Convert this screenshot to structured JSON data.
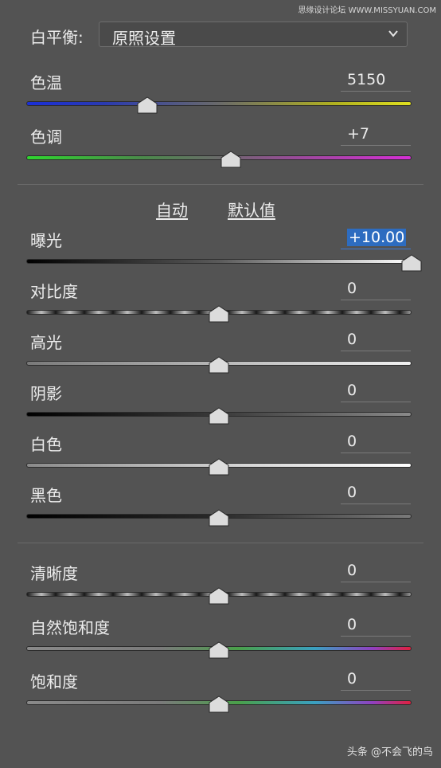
{
  "watermark": "思缘设计论坛 WWW.MISSYUAN.COM",
  "white_balance": {
    "label": "白平衡:",
    "value": "原照设置"
  },
  "actions": {
    "auto": "自动",
    "default": "默认值"
  },
  "sliders": [
    {
      "id": "temperature",
      "label": "色温",
      "value": "5150",
      "position": 0.315,
      "gradient": "linear-gradient(to right,#1a2fd8,#2a3ab0 20%,#6a6a6a 50%,#b0b020 80%,#e0e020)"
    },
    {
      "id": "tint",
      "label": "色调",
      "value": "+7",
      "position": 0.53,
      "gradient": "linear-gradient(to right,#2fd52f,#4a8a4a 30%,#6a6a6a 50%,#9a4a9a 70%,#d52fd5)"
    },
    {
      "id": "exposure",
      "label": "曝光",
      "value": "+10.00",
      "position": 1.0,
      "selected": true,
      "gradient": "linear-gradient(to right,#000000,#5a5a5a 50%,#ffffff)"
    },
    {
      "id": "contrast",
      "label": "对比度",
      "value": "0",
      "position": 0.5,
      "gradient": "repeating-linear-gradient(to right,#1a1a1a 0px,#bdbdbd 18px,#1a1a1a 36px)"
    },
    {
      "id": "highlights",
      "label": "高光",
      "value": "0",
      "position": 0.5,
      "gradient": "linear-gradient(to right,#7a7a7a,#b8b8b8 50%,#f2f2f2)"
    },
    {
      "id": "shadows",
      "label": "阴影",
      "value": "0",
      "position": 0.5,
      "gradient": "linear-gradient(to right,#000000,#3a3a3a 50%,#8a8a8a)"
    },
    {
      "id": "whites",
      "label": "白色",
      "value": "0",
      "position": 0.5,
      "gradient": "linear-gradient(to right,#8a8a8a,#cfcfcf 50%,#ffffff)"
    },
    {
      "id": "blacks",
      "label": "黑色",
      "value": "0",
      "position": 0.5,
      "gradient": "linear-gradient(to right,#000000,#2a2a2a 50%,#7a7a7a)"
    },
    {
      "id": "clarity",
      "label": "清晰度",
      "value": "0",
      "position": 0.5,
      "gradient": "repeating-linear-gradient(to right,#1a1a1a 0px,#bdbdbd 18px,#1a1a1a 36px)"
    },
    {
      "id": "vibrance",
      "label": "自然饱和度",
      "value": "0",
      "position": 0.5,
      "gradient": "linear-gradient(to right,#8a8a8a,#7a7a7a 35%,#4aa04a 55%,#3aa0c0 75%,#9040c0 90%,#e02040)"
    },
    {
      "id": "saturation",
      "label": "饱和度",
      "value": "0",
      "position": 0.5,
      "gradient": "linear-gradient(to right,#8a8a8a,#7a7a7a 35%,#4aa04a 55%,#3aa0c0 75%,#9040c0 90%,#e02040)"
    }
  ],
  "footer": "头条 @不会飞的鸟"
}
